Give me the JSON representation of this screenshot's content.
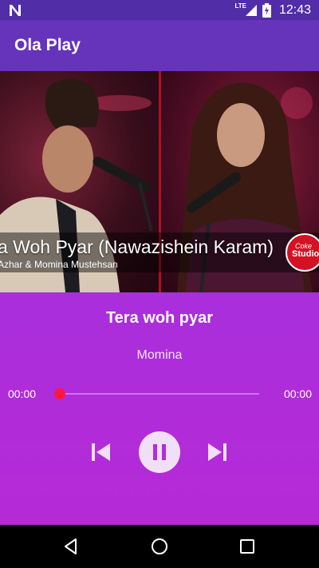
{
  "status_bar": {
    "time": "12:43",
    "network_label": "LTE",
    "icons": [
      "notification-n-icon",
      "signal-icon",
      "battery-icon"
    ]
  },
  "app_bar": {
    "title": "Ola Play"
  },
  "album_art": {
    "caption_title": "a Woh Pyar (Nawazishein Karam)",
    "caption_subtitle": "Azhar & Momina Mustehsan",
    "logo_text_top": "Coke",
    "logo_text_bottom": "Studio"
  },
  "track": {
    "title": "Tera woh pyar",
    "artist": "Momina"
  },
  "progress": {
    "elapsed": "00:00",
    "duration": "00:00",
    "fraction": 0.0
  },
  "controls": {
    "previous_icon": "skip-previous-icon",
    "pause_icon": "pause-icon",
    "next_icon": "skip-next-icon"
  },
  "colors": {
    "status_bar": "#512da8",
    "app_bar": "#6633bb",
    "background_top": "#9b2fd6",
    "background_bottom": "#b62ad6",
    "accent": "#ff1744",
    "play_button": "#f1dff8"
  },
  "nav_bar": {
    "icons": [
      "back-icon",
      "home-icon",
      "recents-icon"
    ]
  }
}
